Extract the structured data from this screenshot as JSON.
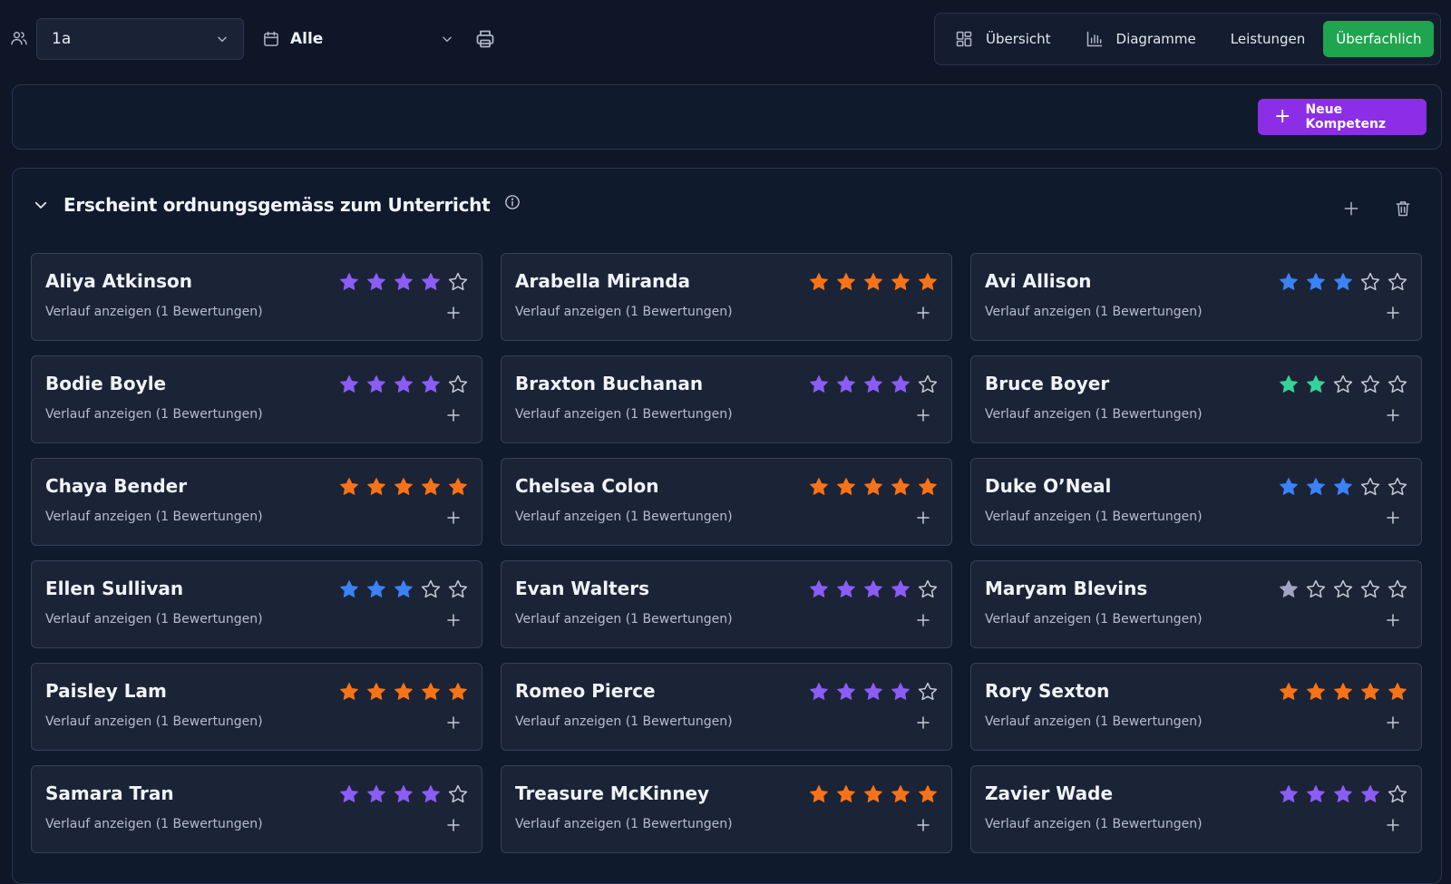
{
  "toolbar": {
    "class_value": "1a",
    "period_value": "Alle"
  },
  "tabs": [
    {
      "label": "Übersicht",
      "icon": "grid-icon"
    },
    {
      "label": "Diagramme",
      "icon": "bar-chart-icon"
    },
    {
      "label": "Leistungen"
    },
    {
      "label": "Überfachlich",
      "active": true
    }
  ],
  "new_button_label": "Neue Kompetenz",
  "section": {
    "title": "Erscheint ordnungsgemäss zum Unterricht"
  },
  "colors": {
    "purple": "#8b5cf6",
    "orange": "#f97316",
    "blue": "#3b82f6",
    "green": "#34d399",
    "gray": "#a3a3c2",
    "empty": "#c7ccd6",
    "active_tab": "#1fa44f",
    "new_button": "#8c2ee6"
  },
  "students": [
    {
      "name": "Aliya Atkinson",
      "history": "Verlauf anzeigen (1 Bewertungen)",
      "rating": 4,
      "color": "purple"
    },
    {
      "name": "Arabella Miranda",
      "history": "Verlauf anzeigen (1 Bewertungen)",
      "rating": 5,
      "color": "orange"
    },
    {
      "name": "Avi Allison",
      "history": "Verlauf anzeigen (1 Bewertungen)",
      "rating": 3,
      "color": "blue"
    },
    {
      "name": "Bodie Boyle",
      "history": "Verlauf anzeigen (1 Bewertungen)",
      "rating": 4,
      "color": "purple"
    },
    {
      "name": "Braxton Buchanan",
      "history": "Verlauf anzeigen (1 Bewertungen)",
      "rating": 4,
      "color": "purple"
    },
    {
      "name": "Bruce Boyer",
      "history": "Verlauf anzeigen (1 Bewertungen)",
      "rating": 2,
      "color": "green"
    },
    {
      "name": "Chaya Bender",
      "history": "Verlauf anzeigen (1 Bewertungen)",
      "rating": 5,
      "color": "orange"
    },
    {
      "name": "Chelsea Colon",
      "history": "Verlauf anzeigen (1 Bewertungen)",
      "rating": 5,
      "color": "orange"
    },
    {
      "name": "Duke O’Neal",
      "history": "Verlauf anzeigen (1 Bewertungen)",
      "rating": 3,
      "color": "blue"
    },
    {
      "name": "Ellen Sullivan",
      "history": "Verlauf anzeigen (1 Bewertungen)",
      "rating": 3,
      "color": "blue"
    },
    {
      "name": "Evan Walters",
      "history": "Verlauf anzeigen (1 Bewertungen)",
      "rating": 4,
      "color": "purple"
    },
    {
      "name": "Maryam Blevins",
      "history": "Verlauf anzeigen (1 Bewertungen)",
      "rating": 1,
      "color": "gray"
    },
    {
      "name": "Paisley Lam",
      "history": "Verlauf anzeigen (1 Bewertungen)",
      "rating": 5,
      "color": "orange"
    },
    {
      "name": "Romeo Pierce",
      "history": "Verlauf anzeigen (1 Bewertungen)",
      "rating": 4,
      "color": "purple"
    },
    {
      "name": "Rory Sexton",
      "history": "Verlauf anzeigen (1 Bewertungen)",
      "rating": 5,
      "color": "orange"
    },
    {
      "name": "Samara Tran",
      "history": "Verlauf anzeigen (1 Bewertungen)",
      "rating": 4,
      "color": "purple"
    },
    {
      "name": "Treasure McKinney",
      "history": "Verlauf anzeigen (1 Bewertungen)",
      "rating": 5,
      "color": "orange"
    },
    {
      "name": "Zavier Wade",
      "history": "Verlauf anzeigen (1 Bewertungen)",
      "rating": 4,
      "color": "purple"
    }
  ]
}
